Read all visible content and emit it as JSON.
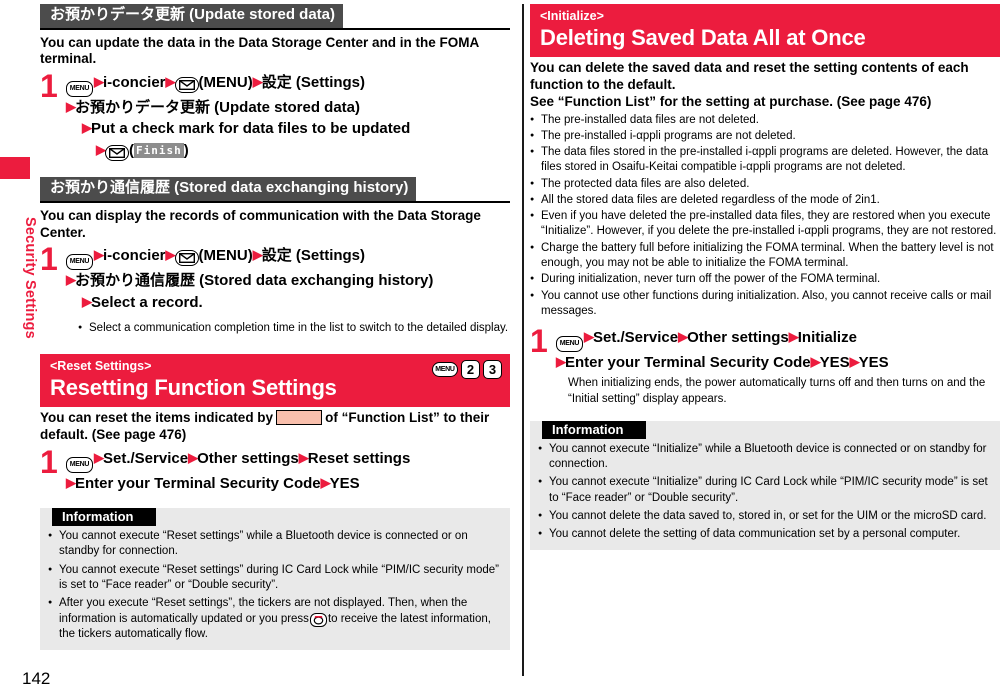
{
  "sidebar": {
    "chapter_label": "Security Settings",
    "tab_color": "#ec1c3e"
  },
  "page_number": "142",
  "colors": {
    "red": "#ec1c3e",
    "gray_header": "#4c4c4c",
    "info_bg": "#e9e9e9",
    "swatch": "#f9bfac"
  },
  "left_column": {
    "sections": [
      {
        "id": "update-stored-data",
        "header_type": "gray",
        "header": "お預かりデータ更新 (Update stored data)",
        "lead": "You can update the data in the Data Storage Center and in the FOMA terminal.",
        "step_number": "1",
        "step_lines": [
          "i-concier",
          "(MENU)",
          "設定 (Settings)",
          "お預かりデータ更新 (Update stored data)",
          "Put a check mark for data files to be updated",
          "(",
          "Finish",
          ")"
        ],
        "keys": {
          "menu": "MENU",
          "mail": "mail-key-icon"
        }
      },
      {
        "id": "stored-data-exchanging-history",
        "header_type": "gray",
        "header": "お預かり通信履歴 (Stored data exchanging history)",
        "lead": "You can display the records of communication with the Data Storage Center.",
        "step_number": "1",
        "step_lines": [
          "i-concier",
          "(MENU)",
          "設定 (Settings)",
          "お預かり通信履歴 (Stored data exchanging history)",
          "Select a record."
        ],
        "notes": [
          "Select a communication completion time in the list to switch to the detailed display."
        ]
      },
      {
        "id": "reset-settings",
        "header_type": "red",
        "header_sub": "<Reset Settings>",
        "header_main": "Resetting Function Settings",
        "shortcut_keys": [
          "MENU",
          "2",
          "3"
        ],
        "lead_part1": "You can reset the items indicated by",
        "lead_part2": "of “Function List” to their default. (See page 476)",
        "step_number": "1",
        "step_lines": [
          "Set./Service",
          "Other settings",
          "Reset settings",
          "Enter your Terminal Security Code",
          "YES"
        ],
        "information": {
          "title": "Information",
          "items": [
            "You cannot execute “Reset settings” while a Bluetooth device is connected or on standby for connection.",
            "You cannot execute “Reset settings” during IC Card Lock while “PIM/IC security mode” is set to “Face reader” or “Double security”.",
            "After you execute “Reset settings”, the tickers are not displayed. Then, when the information is automatically updated or you press"
          ],
          "item3_tail": "to receive the latest information, the tickers automatically flow."
        }
      }
    ]
  },
  "right_column": {
    "section": {
      "id": "initialize",
      "header_type": "red",
      "header_sub": "<Initialize>",
      "header_main": "Deleting Saved Data All at Once",
      "lead_line1": "You can delete the saved data and reset the setting contents of each function to the default.",
      "lead_line2": "See “Function List” for the setting at purchase. (See page 476)",
      "bullets": [
        "The pre-installed data files are not deleted.",
        "The pre-installed i-αppli programs are not deleted.",
        "The data files stored in the pre-installed i-αppli programs are deleted. However, the data files stored in Osaifu-Keitai compatible i-αppli programs are not deleted.",
        "The protected data files are also deleted.",
        "All the stored data files are deleted regardless of the mode of 2in1.",
        "Even if you have deleted the pre-installed data files, they are restored when you execute “Initialize”. However, if you delete the pre-installed i-αppli programs, they are not restored.",
        "Charge the battery full before initializing the FOMA terminal. When the battery level is not enough, you may not be able to initialize the FOMA terminal.",
        "During initialization, never turn off the power of the FOMA terminal.",
        "You cannot use other functions during initialization. Also, you cannot receive calls or mail messages."
      ],
      "step_number": "1",
      "step_lines": [
        "Set./Service",
        "Other settings",
        "Initialize",
        "Enter your Terminal Security Code",
        "YES",
        "YES"
      ],
      "step_note": "When initializing ends, the power automatically turns off and then turns on and the “Initial setting” display appears.",
      "information": {
        "title": "Information",
        "items": [
          "You cannot execute “Initialize” while a Bluetooth device is connected or on standby for connection.",
          "You cannot execute “Initialize” during IC Card Lock while “PIM/IC security mode” is set to “Face reader” or “Double security”.",
          "You cannot delete the data saved to, stored in, or set for the UIM or the microSD card.",
          "You cannot delete the setting of data communication set by a personal computer."
        ]
      }
    }
  }
}
